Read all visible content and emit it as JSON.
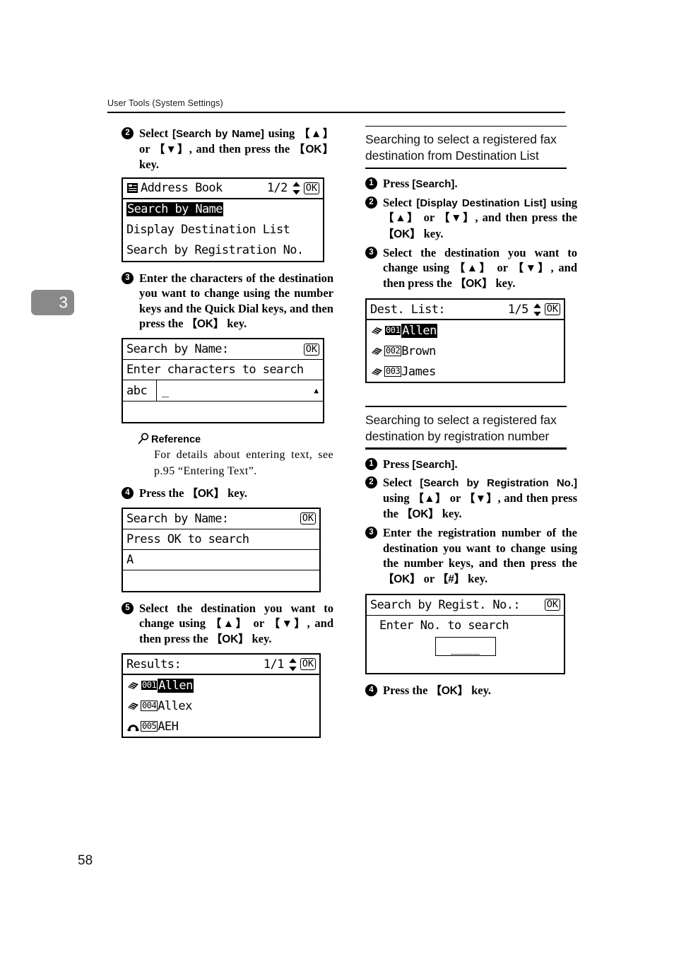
{
  "running_header": "User Tools (System Settings)",
  "chapter_tab": "3",
  "page_number": "58",
  "left_column": {
    "step2": {
      "num": "2",
      "text_parts": [
        "Select ",
        "[Search by Name]",
        " using ",
        "【▲】",
        " or ",
        "【▼】",
        ", and then press the ",
        "【OK】",
        " key."
      ]
    },
    "lcd_address_book": {
      "title": "Address Book",
      "page_indicator": "1/2",
      "ok_label": "OK",
      "items": [
        {
          "label": "Search by Name",
          "selected": true
        },
        {
          "label": "Display Destination List",
          "selected": false
        },
        {
          "label": "Search by Registration No.",
          "selected": false
        }
      ]
    },
    "step3": {
      "num": "3",
      "text": "Enter the characters of the destination you want to change using the number keys and the Quick Dial keys, and then press the 【OK】 key."
    },
    "lcd_search_by_name_empty": {
      "title": "Search by Name:",
      "ok_label": "OK",
      "prompt": "Enter characters to search",
      "mode_label": "abc",
      "entry_value": "_",
      "caret_marker": "▲"
    },
    "reference": {
      "heading": "Reference",
      "body": "For details about entering text, see p.95 “Entering Text”."
    },
    "step4": {
      "num": "4",
      "text_parts": [
        "Press the ",
        "【OK】",
        " key."
      ]
    },
    "lcd_search_by_name_filled": {
      "title": "Search by Name:",
      "ok_label": "OK",
      "prompt": "Press OK to search",
      "entry_value": "A"
    },
    "step5": {
      "num": "5",
      "text": "Select the destination you want to change using 【▲】 or 【▼】, and then press the 【OK】 key."
    },
    "lcd_results": {
      "title": "Results:",
      "page_indicator": "1/1",
      "ok_label": "OK",
      "items": [
        {
          "icon": "fax-icon",
          "reg_no": "001",
          "name": "Allen",
          "selected": true
        },
        {
          "icon": "fax-icon",
          "reg_no": "004",
          "name": "Allex",
          "selected": false
        },
        {
          "icon": "telephone-icon",
          "reg_no": "005",
          "name": "AEH",
          "selected": false
        }
      ]
    }
  },
  "right_column": {
    "section1": {
      "heading": "Searching to select a registered fax destination from Destination List",
      "step1": {
        "num": "1",
        "text_parts": [
          "Press ",
          "[Search]",
          "."
        ]
      },
      "step2": {
        "num": "2",
        "text_parts": [
          "Select ",
          "[Display Destination List]",
          " using ",
          "【▲】",
          " or ",
          "【▼】",
          ", and then press the ",
          "【OK】",
          " key."
        ]
      },
      "step3": {
        "num": "3",
        "text": "Select the destination you want to change using 【▲】 or 【▼】, and then press the 【OK】 key."
      },
      "lcd_dest_list": {
        "title": "Dest. List:",
        "page_indicator": "1/5",
        "ok_label": "OK",
        "items": [
          {
            "icon": "fax-icon",
            "reg_no": "001",
            "name": "Allen",
            "selected": true
          },
          {
            "icon": "fax-icon",
            "reg_no": "002",
            "name": "Brown",
            "selected": false
          },
          {
            "icon": "fax-icon",
            "reg_no": "003",
            "name": "James",
            "selected": false
          }
        ]
      }
    },
    "section2": {
      "heading": "Searching to select a registered fax destination by registration number",
      "step1": {
        "num": "1",
        "text_parts": [
          "Press ",
          "[Search]",
          "."
        ]
      },
      "step2": {
        "num": "2",
        "text_parts": [
          "Select ",
          "[Search by Registration No.]",
          " using ",
          "【▲】",
          " or ",
          "【▼】",
          ", and then press the ",
          "【OK】",
          " key."
        ]
      },
      "step3": {
        "num": "3",
        "text": "Enter the registration number of the destination you want to change using the number keys, and then press the 【OK】 or 【#】 key."
      },
      "lcd_regist_no": {
        "title": "Search by Regist. No.:",
        "ok_label": "OK",
        "prompt": "Enter No. to search",
        "entry_value": "____"
      },
      "step4": {
        "num": "4",
        "text_parts": [
          "Press the ",
          "【OK】",
          " key."
        ]
      }
    }
  }
}
